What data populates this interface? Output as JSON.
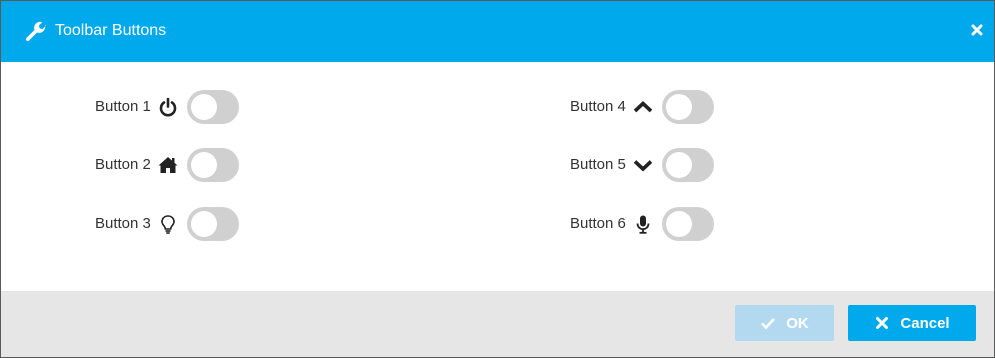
{
  "dialog": {
    "title": "Toolbar Buttons",
    "title_icon": "wrench-icon",
    "close_icon": "close-icon"
  },
  "buttons": [
    {
      "label": "Button 1",
      "icon": "power-icon",
      "enabled": false
    },
    {
      "label": "Button 2",
      "icon": "home-icon",
      "enabled": false
    },
    {
      "label": "Button 3",
      "icon": "lightbulb-icon",
      "enabled": false
    },
    {
      "label": "Button 4",
      "icon": "chevron-up-icon",
      "enabled": false
    },
    {
      "label": "Button 5",
      "icon": "chevron-down-icon",
      "enabled": false
    },
    {
      "label": "Button 6",
      "icon": "microphone-icon",
      "enabled": false
    }
  ],
  "footer": {
    "ok_label": "OK",
    "ok_icon": "check-icon",
    "ok_disabled": true,
    "cancel_label": "Cancel",
    "cancel_icon": "times-icon"
  },
  "colors": {
    "accent": "#00a9ec",
    "accent_disabled": "#b3d9f0",
    "toggle_off": "#d0d0d0",
    "footer_bg": "#e6e6e6",
    "text": "#333333"
  }
}
